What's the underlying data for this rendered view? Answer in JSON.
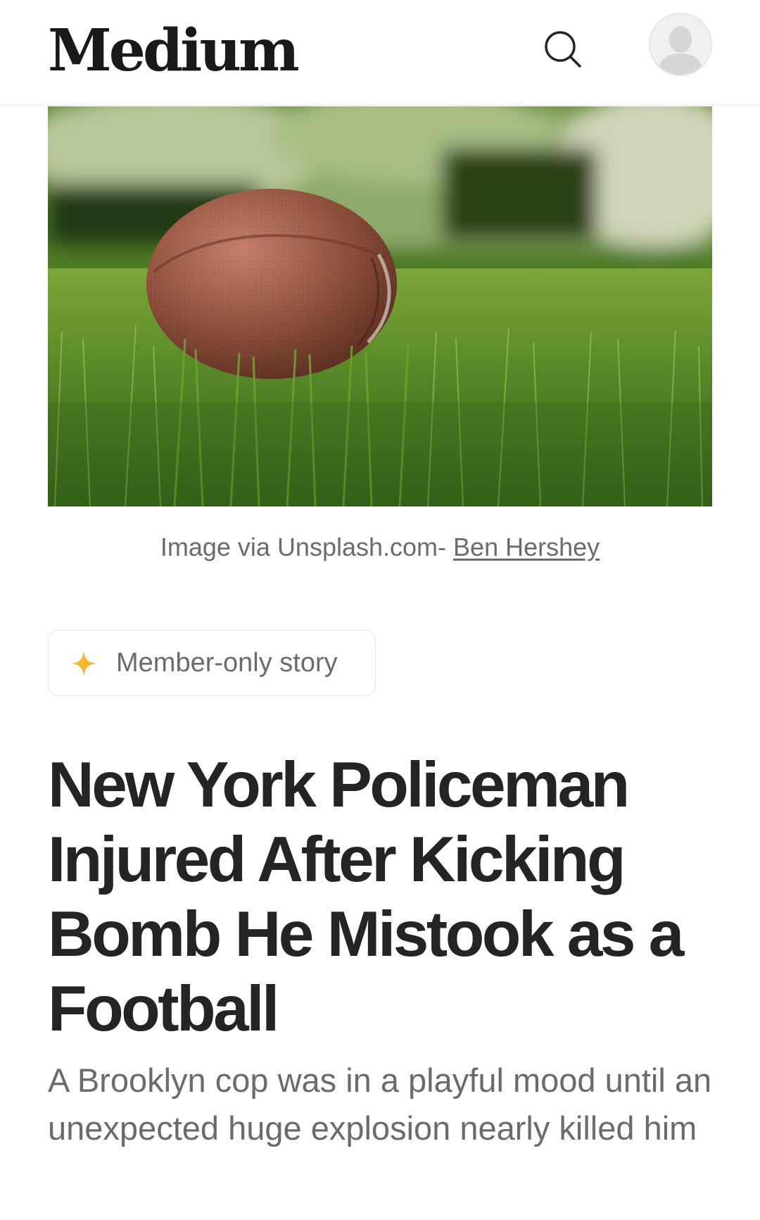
{
  "header": {
    "logo": "Medium",
    "search_icon": "search-icon",
    "avatar_icon": "user-avatar-icon"
  },
  "hero": {
    "image_description_icon": "football-on-grass-photo",
    "caption_prefix": "Image via Unsplash.com- ",
    "caption_link": "Ben Hershey"
  },
  "badge": {
    "icon": "star-icon",
    "label": "Member-only story",
    "accent_color": "#f5b82e"
  },
  "article": {
    "title": "New York Policeman Injured After Kicking Bomb He Mistook as a Football",
    "subtitle": "A Brooklyn cop was in a playful mood until an unexpected huge explosion nearly killed him"
  },
  "colors": {
    "text_primary": "#242424",
    "text_secondary": "#6b6b6b",
    "border": "#e6e6e6"
  }
}
